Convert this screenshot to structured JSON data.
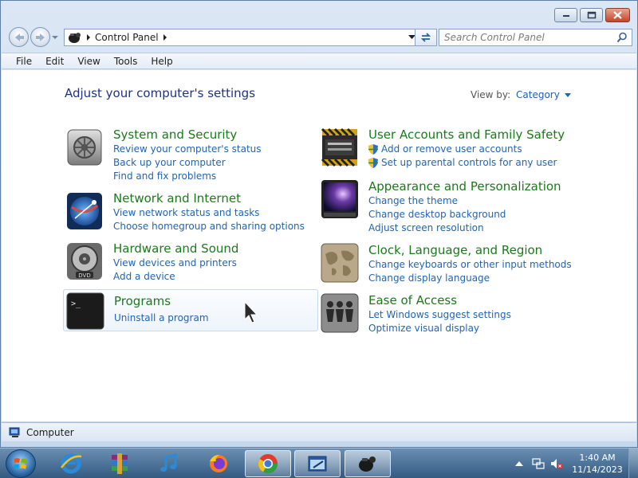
{
  "window": {
    "caption_buttons": [
      "minimize",
      "maximize",
      "close"
    ]
  },
  "address_bar": {
    "crumb": "Control Panel",
    "search_placeholder": "Search Control Panel"
  },
  "menubar": [
    "File",
    "Edit",
    "View",
    "Tools",
    "Help"
  ],
  "content": {
    "page_title": "Adjust your computer's settings",
    "view_by_label": "View by:",
    "view_by_value": "Category",
    "categories": [
      {
        "title": "System and Security",
        "icon": "vault-icon",
        "links": [
          "Review your computer's status",
          "Back up your computer",
          "Find and fix problems"
        ]
      },
      {
        "title": "Network and Internet",
        "icon": "globe-network-icon",
        "links": [
          "View network status and tasks",
          "Choose homegroup and sharing options"
        ]
      },
      {
        "title": "Hardware and Sound",
        "icon": "dvd-speaker-icon",
        "links": [
          "View devices and printers",
          "Add a device"
        ]
      },
      {
        "title": "Programs",
        "icon": "terminal-icon",
        "links": [
          "Uninstall a program"
        ]
      },
      {
        "title": "User Accounts and Family Safety",
        "icon": "badge-icon",
        "links": [
          "Add or remove user accounts",
          "Set up parental controls for any user"
        ]
      },
      {
        "title": "Appearance and Personalization",
        "icon": "monitor-wallpaper-icon",
        "links": [
          "Change the theme",
          "Change desktop background",
          "Adjust screen resolution"
        ]
      },
      {
        "title": "Clock, Language, and Region",
        "icon": "world-map-icon",
        "links": [
          "Change keyboards or other input methods",
          "Change display language"
        ]
      },
      {
        "title": "Ease of Access",
        "icon": "people-icon",
        "links": [
          "Let Windows suggest settings",
          "Optimize visual display"
        ]
      }
    ]
  },
  "statusbar": {
    "text": "Computer"
  },
  "taskbar": {
    "items": [
      "internet-explorer-icon",
      "winrar-icon",
      "itunes-icon",
      "firefox-icon",
      "chrome-icon",
      "window-app-icon",
      "control-panel-icon"
    ],
    "clock_time": "1:40 AM",
    "clock_date": "11/14/2023"
  },
  "colors": {
    "category_title": "#1a7a1a",
    "link": "#1f64b4",
    "page_title": "#1e3287"
  }
}
